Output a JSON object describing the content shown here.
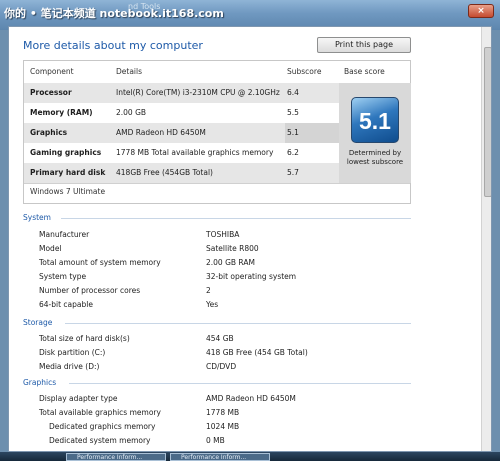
{
  "watermark": "你的 • 笔记本频道 notebook.it168.com",
  "window_title_fragment": "nd Tools",
  "heading": "More details about my computer",
  "print_button": "Print this page",
  "score_table": {
    "headers": {
      "component": "Component",
      "details": "Details",
      "subscore": "Subscore",
      "base": "Base score"
    },
    "rows": [
      {
        "component": "Processor",
        "details": "Intel(R) Core(TM) i3-2310M CPU @ 2.10GHz",
        "subscore": "6.4"
      },
      {
        "component": "Memory (RAM)",
        "details": "2.00 GB",
        "subscore": "5.5"
      },
      {
        "component": "Graphics",
        "details": "AMD Radeon HD 6450M",
        "subscore": "5.1"
      },
      {
        "component": "Gaming graphics",
        "details": "1778 MB Total available graphics memory",
        "subscore": "6.2"
      },
      {
        "component": "Primary hard disk",
        "details": "418GB Free (454GB Total)",
        "subscore": "5.7"
      }
    ],
    "base_score": "5.1",
    "base_caption": "Determined by lowest subscore",
    "os": "Windows 7 Ultimate"
  },
  "sections": {
    "system": {
      "title": "System",
      "items": [
        {
          "k": "Manufacturer",
          "v": "TOSHIBA"
        },
        {
          "k": "Model",
          "v": "Satellite R800"
        },
        {
          "k": "Total amount of system memory",
          "v": "2.00 GB RAM"
        },
        {
          "k": "System type",
          "v": "32-bit operating system"
        },
        {
          "k": "Number of processor cores",
          "v": "2"
        },
        {
          "k": "64-bit capable",
          "v": "Yes"
        }
      ]
    },
    "storage": {
      "title": "Storage",
      "items": [
        {
          "k": "Total size of hard disk(s)",
          "v": "454 GB"
        },
        {
          "k": "Disk partition (C:)",
          "v": "418 GB Free (454 GB Total)"
        },
        {
          "k": "Media drive (D:)",
          "v": "CD/DVD"
        }
      ]
    },
    "graphics": {
      "title": "Graphics",
      "items": [
        {
          "k": "Display adapter type",
          "v": "AMD Radeon HD 6450M"
        },
        {
          "k": "Total available graphics memory",
          "v": "1778 MB"
        },
        {
          "k": "Dedicated graphics memory",
          "v": "1024 MB"
        },
        {
          "k": "Dedicated system memory",
          "v": "0 MB"
        }
      ]
    }
  },
  "taskbar": {
    "items": [
      "Performance Inform...",
      "Performance Inform..."
    ]
  }
}
